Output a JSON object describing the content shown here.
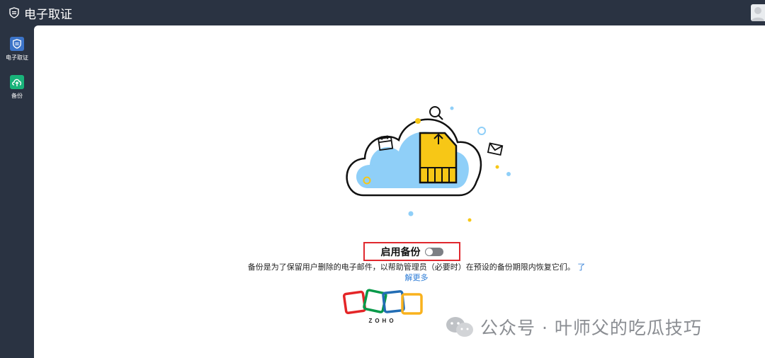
{
  "app": {
    "title": "电子取证"
  },
  "sidebar": {
    "items": [
      {
        "label": "电子取证",
        "color": "#3c74c8"
      },
      {
        "label": "备份",
        "color": "#19b37a"
      }
    ]
  },
  "main": {
    "toggle_label": "启用备份",
    "toggle_on": false,
    "description": "备份是为了保留用户删除的电子邮件，以帮助管理员（必要时）在预设的备份期限内恢复它们。",
    "learn_more_prefix": "了",
    "learn_more_rest": "解更多",
    "logo_text": "ZOHO"
  },
  "watermark": {
    "text": "公众号 · 叶师父的吃瓜技巧"
  },
  "colors": {
    "topbar": "#2a3342",
    "cloud": "#8fcff8",
    "card": "#f7c716",
    "highlight_box": "#e0282e",
    "link": "#2b7bd6"
  }
}
